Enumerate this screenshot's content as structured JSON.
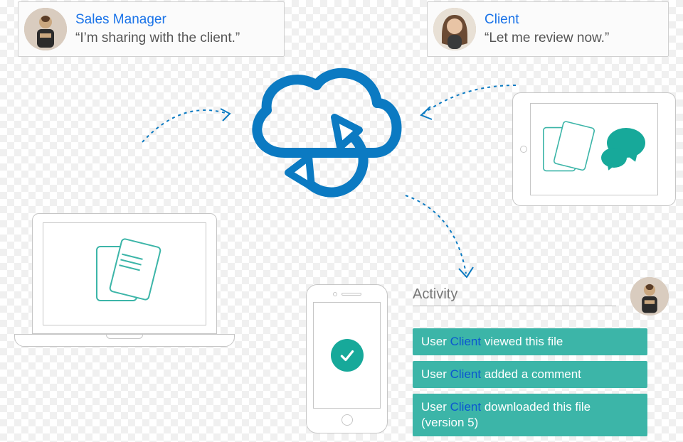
{
  "speakers": {
    "salesManager": {
      "role": "Sales Manager",
      "quote": "“I’m sharing with the client.”"
    },
    "client": {
      "role": "Client",
      "quote": "“Let me review now.”"
    }
  },
  "activity": {
    "title": "Activity",
    "items": [
      {
        "prefix": "User ",
        "actor": "Client",
        "suffix": " viewed this file"
      },
      {
        "prefix": "User ",
        "actor": "Client",
        "suffix": " added a comment"
      },
      {
        "prefix": "User ",
        "actor": "Client",
        "suffix": " downloaded this file",
        "extra": "(version 5)"
      }
    ]
  },
  "colors": {
    "blue": "#1a73e8",
    "teal": "#17a99a",
    "tealLight": "#3cb5a8"
  }
}
